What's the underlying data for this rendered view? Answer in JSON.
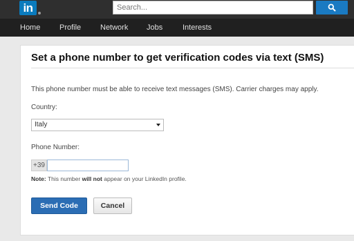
{
  "header": {
    "logo_text": "in",
    "search_placeholder": "Search...",
    "search_icon": "search-icon",
    "brand_color": "#0a7bbd"
  },
  "nav": {
    "items": [
      {
        "label": "Home"
      },
      {
        "label": "Profile"
      },
      {
        "label": "Network"
      },
      {
        "label": "Jobs"
      },
      {
        "label": "Interests"
      }
    ]
  },
  "form": {
    "title": "Set a phone number to get verification codes via text (SMS)",
    "info": "This phone number must be able to receive text messages (SMS). Carrier charges may apply.",
    "country_label": "Country:",
    "country_value": "Italy",
    "phone_label": "Phone Number:",
    "phone_prefix": "+39",
    "phone_value": "",
    "note_label": "Note:",
    "note_text_1": "This number",
    "note_emphasis": "will not",
    "note_text_2": "appear on your LinkedIn profile.",
    "send_label": "Send Code",
    "cancel_label": "Cancel",
    "send_color": "#2b6db4"
  }
}
